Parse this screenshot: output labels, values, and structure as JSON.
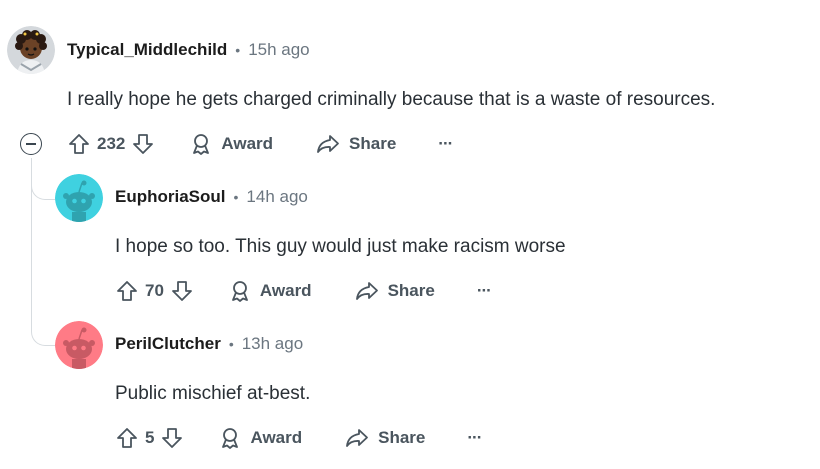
{
  "comments": [
    {
      "author": "Typical_Middlechild",
      "time": "15h ago",
      "body": "I really hope he gets charged criminally because that is a waste of resources.",
      "votes": "232",
      "award_label": "Award",
      "share_label": "Share",
      "more_label": "···",
      "avatar_color": "#c9cdd1"
    },
    {
      "author": "EuphoriaSoul",
      "time": "14h ago",
      "body": "I hope so too. This guy would just make racism worse",
      "votes": "70",
      "award_label": "Award",
      "share_label": "Share",
      "more_label": "···",
      "avatar_color": "#3fd1e0"
    },
    {
      "author": "PerilClutcher",
      "time": "13h ago",
      "body": "Public mischief at-best.",
      "votes": "5",
      "award_label": "Award",
      "share_label": "Share",
      "more_label": "···",
      "avatar_color": "#ff7b86"
    }
  ],
  "separator": "•",
  "colors": {
    "text": "#2a3036",
    "muted": "#6b7680",
    "action": "#4a555e",
    "thread": "#d7dce0"
  }
}
